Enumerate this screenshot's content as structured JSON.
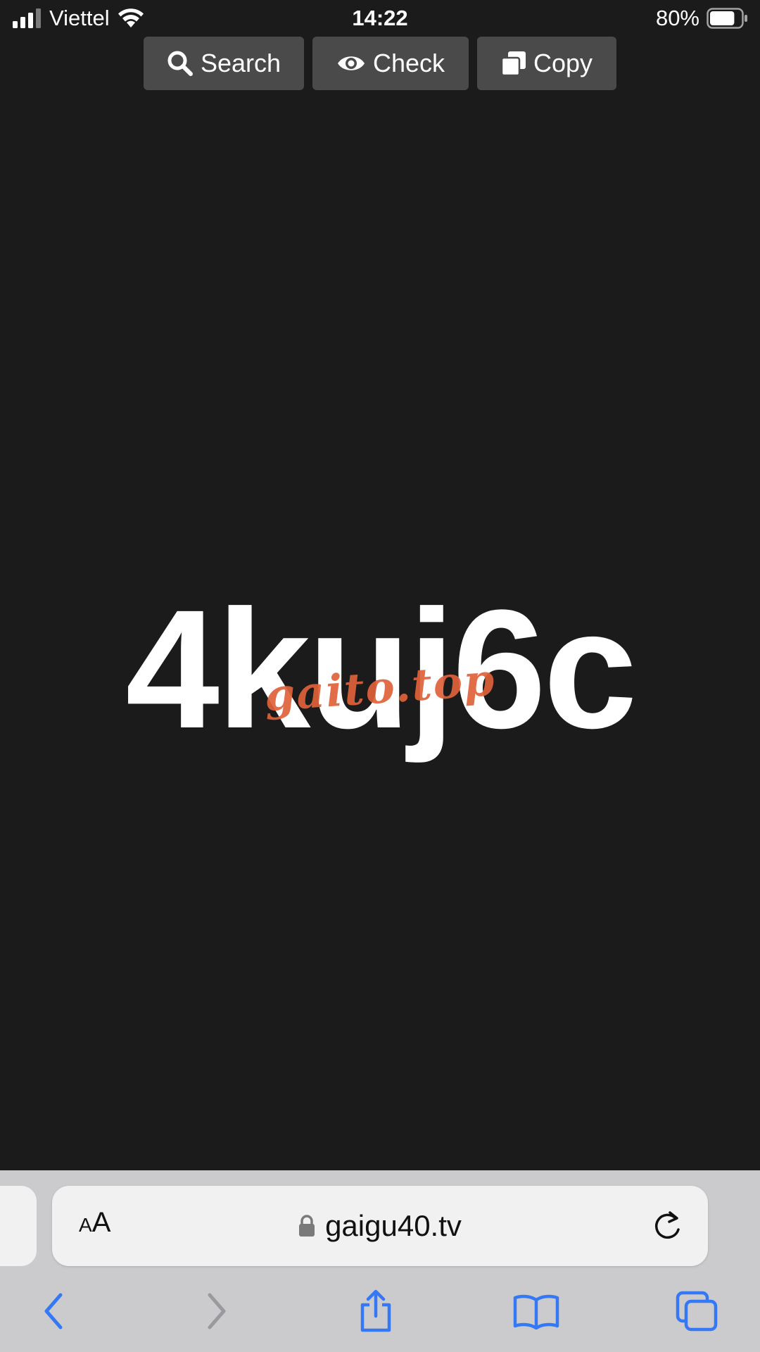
{
  "status_bar": {
    "carrier": "Viettel",
    "time": "14:22",
    "battery_percent": "80%",
    "battery_level": 0.8,
    "signal_icon": "cellular-signal-icon",
    "wifi_icon": "wifi-icon",
    "battery_icon": "battery-icon"
  },
  "toolbar": {
    "search_label": "Search",
    "check_label": "Check",
    "copy_label": "Copy",
    "search_icon": "search-icon",
    "check_icon": "eye-icon",
    "copy_icon": "copy-icon"
  },
  "main": {
    "code": "4kuj6c",
    "watermark": "gaito.top"
  },
  "browser": {
    "text_size_small": "A",
    "text_size_large": "A",
    "url": "gaigu40.tv",
    "icons": {
      "lock": "lock-icon",
      "reload": "reload-icon",
      "back": "back-chevron-icon",
      "forward": "forward-chevron-icon",
      "share": "share-icon",
      "bookmarks": "book-icon",
      "tabs": "tabs-icon"
    }
  },
  "colors": {
    "background": "#1b1b1b",
    "button_bg": "#4a4a4a",
    "watermark": "#e0623a",
    "browser_chrome": "#cbcbcd",
    "accent": "#3478f6"
  }
}
